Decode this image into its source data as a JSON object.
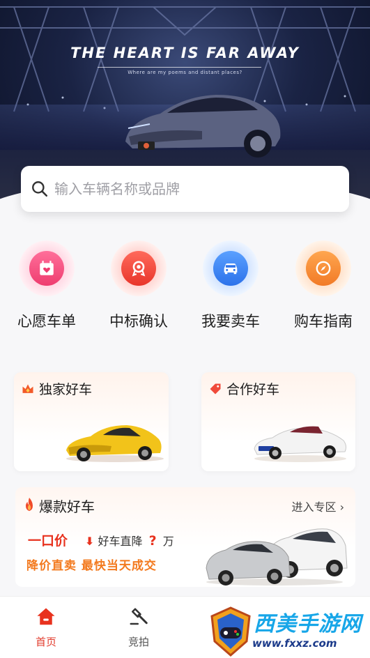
{
  "hero": {
    "title": "THE HEART IS FAR AWAY",
    "subtitle": "Where are my poems and distant places?"
  },
  "search": {
    "placeholder": "输入车辆名称或品牌"
  },
  "quick_actions": [
    {
      "label": "心愿车单",
      "icon": "wishlist-calendar-heart-icon",
      "color": "#f0457a"
    },
    {
      "label": "中标确认",
      "icon": "award-ribbon-icon",
      "color": "#f04237"
    },
    {
      "label": "我要卖车",
      "icon": "car-icon",
      "color": "#2f7ef0"
    },
    {
      "label": "购车指南",
      "icon": "compass-icon",
      "color": "#f3832b"
    }
  ],
  "cards": {
    "exclusive": {
      "title": "独家好车",
      "icon": "crown-icon"
    },
    "partner": {
      "title": "合作好车",
      "icon": "tag-icon"
    }
  },
  "hot": {
    "title": "爆款好车",
    "more": "进入专区 ›",
    "price": "一口价",
    "drop": "好车直降",
    "drop_amount": "?",
    "drop_unit": "万",
    "slogan": "降价直卖  最快当天成交"
  },
  "tabbar": [
    {
      "label": "首页",
      "icon": "home-icon",
      "active": true
    },
    {
      "label": "竞拍",
      "icon": "auction-hammer-icon",
      "active": false
    }
  ],
  "watermark": {
    "text": "西美手游网",
    "url": "www.fxxz.com"
  },
  "colors": {
    "accent": "#e23b2c",
    "orange": "#f37a1f"
  }
}
